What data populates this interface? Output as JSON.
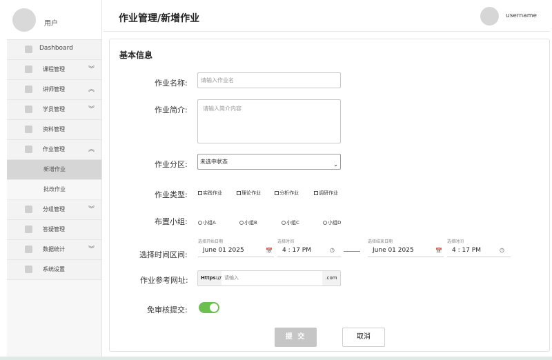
{
  "sidebar": {
    "username": "用户",
    "items": [
      {
        "label": "Dashboard",
        "arrow": ""
      },
      {
        "label": "课程管理",
        "arrow": "down"
      },
      {
        "label": "讲师管理",
        "arrow": "up"
      },
      {
        "label": "学员管理",
        "arrow": "down"
      },
      {
        "label": "资料管理",
        "arrow": ""
      },
      {
        "label": "作业管理",
        "arrow": "up"
      },
      {
        "label": "分组管理",
        "arrow": "down"
      },
      {
        "label": "答疑管理",
        "arrow": ""
      },
      {
        "label": "数据统计",
        "arrow": "down"
      },
      {
        "label": "系统设置",
        "arrow": ""
      }
    ],
    "subitems": [
      {
        "label": "新增作业",
        "active": true
      },
      {
        "label": "批改作业",
        "active": false
      }
    ]
  },
  "header": {
    "title": "作业管理/新增作业",
    "user": "username"
  },
  "form": {
    "section_title": "基本信息",
    "name": {
      "label": "作业名称:",
      "placeholder": "请输入作业名"
    },
    "intro": {
      "label": "作业简介:",
      "placeholder": "请输入简介内容"
    },
    "zone": {
      "label": "作业分区:",
      "selected": "未选中状态"
    },
    "type": {
      "label": "作业类型:",
      "options": [
        "实践作业",
        "理论作业",
        "分析作业",
        "调研作业"
      ]
    },
    "group": {
      "label": "布置小组:",
      "options": [
        "小组A",
        "小组B",
        "小组C",
        "小组D"
      ]
    },
    "range": {
      "label": "选择时间区间:",
      "start_date_label": "选择开始日期",
      "start_date": "June 01 2025",
      "start_time_label": "选择时间",
      "start_time": "4 : 17 PM",
      "end_date_label": "选择结束日期",
      "end_date": "June 01 2025",
      "end_time_label": "选择时间",
      "end_time": "4 : 17 PM"
    },
    "url": {
      "label": "作业参考网址:",
      "prefix": "Https://",
      "placeholder": "请输入",
      "suffix": ".com"
    },
    "auto_submit": {
      "label": "免审核提交:",
      "on": true
    },
    "submit_label": "提 交",
    "cancel_label": "取消"
  },
  "colors": {
    "toggle_on": "#6bbf4e",
    "submit_disabled": "#c6c6c6"
  }
}
